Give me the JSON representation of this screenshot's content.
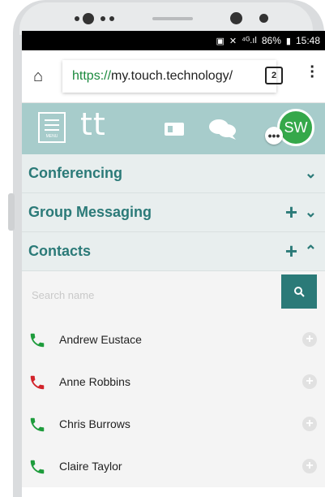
{
  "statusbar": {
    "icons": [
      "screenshot-icon",
      "mute-icon",
      "4g-signal-icon",
      "battery-icon"
    ],
    "battery": "86%",
    "time": "15:48"
  },
  "browser": {
    "url_scheme": "https://",
    "url_host": "my.touch.technology/",
    "tab_count": "2"
  },
  "app": {
    "menu_label": "MENU",
    "logo": "tt",
    "avatar_initials": "SW",
    "status_bubble": "•••"
  },
  "sections": {
    "conferencing": {
      "title": "Conferencing"
    },
    "group_messaging": {
      "title": "Group Messaging"
    },
    "contacts": {
      "title": "Contacts"
    }
  },
  "search": {
    "placeholder": "Search name"
  },
  "contacts": [
    {
      "name": "Andrew Eustace",
      "status": "available"
    },
    {
      "name": "Anne Robbins",
      "status": "busy"
    },
    {
      "name": "Chris Burrows",
      "status": "available"
    },
    {
      "name": "Claire Taylor",
      "status": "available"
    }
  ],
  "colors": {
    "accent": "#2b7a78",
    "header": "#a7cccb",
    "available": "#1e9c3c",
    "busy": "#d2232a",
    "avatar": "#35a84a"
  }
}
